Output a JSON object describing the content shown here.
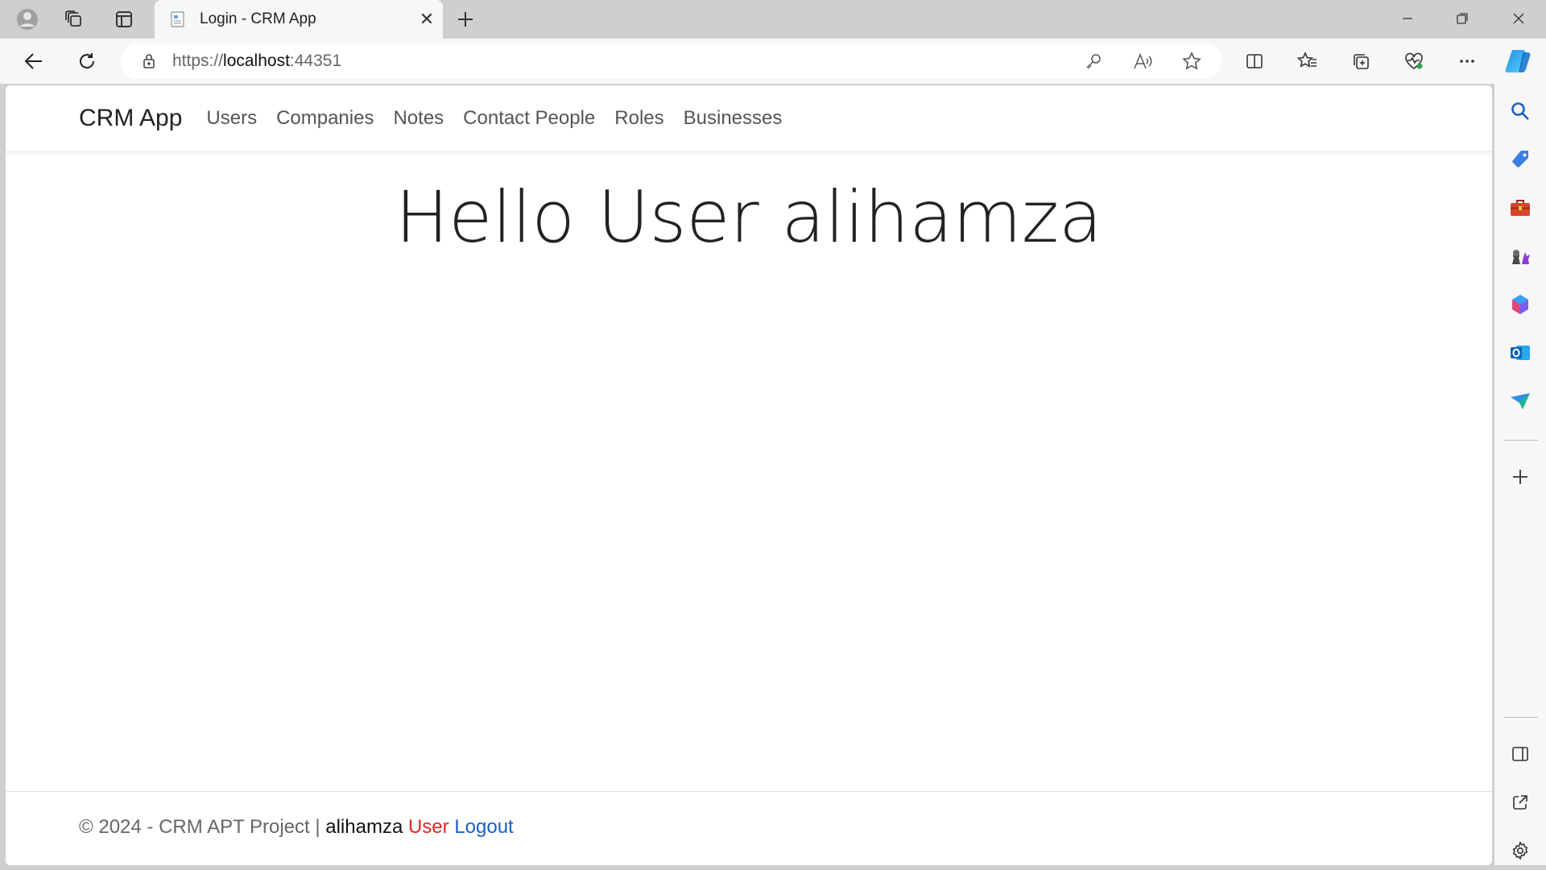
{
  "browser": {
    "tab_title": "Login - CRM App",
    "url_prefix": "https://",
    "url_host": "localhost",
    "url_port": ":44351",
    "icons": {
      "profile": "profile-icon",
      "workspaces": "workspaces-icon",
      "tab_actions": "tab-actions-icon",
      "new_tab": "plus-icon",
      "minimize": "minimize-icon",
      "restore": "restore-icon",
      "close": "close-icon",
      "back": "back-arrow-icon",
      "refresh": "refresh-icon",
      "lock": "lock-icon",
      "password": "key-icon",
      "read_aloud": "read-aloud-icon",
      "favorite": "star-icon",
      "split_screen": "split-screen-icon",
      "favorites": "favorites-icon",
      "collections": "collections-icon",
      "browser_essentials": "heart-pulse-icon",
      "more": "more-icon",
      "copilot": "copilot-icon"
    },
    "sidebar_icons": [
      "search-icon",
      "tag-icon",
      "briefcase-icon",
      "games-icon",
      "microsoft365-icon",
      "outlook-icon",
      "drop-icon",
      "add-icon",
      "sidebar-toggle-icon",
      "external-link-icon",
      "settings-icon"
    ]
  },
  "app": {
    "brand": "CRM App",
    "nav": [
      "Users",
      "Companies",
      "Notes",
      "Contact People",
      "Roles",
      "Businesses"
    ],
    "heading": "Hello User alihamza",
    "footer": {
      "copyright": "© 2024 - CRM APT Project |",
      "username": "alihamza",
      "role": "User",
      "logout": "Logout"
    }
  },
  "colors": {
    "role_text": "#e02424",
    "logout_link": "#1a5fc4",
    "copilot_accent": "#1b8fe6"
  }
}
